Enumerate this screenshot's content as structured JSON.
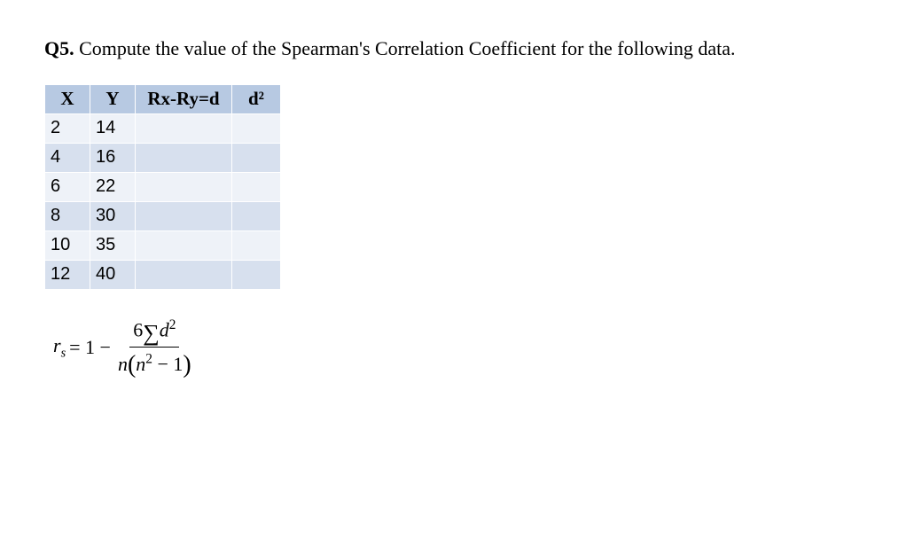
{
  "question": {
    "number": "Q5.",
    "text": "Compute the value of the Spearman's Correlation Coefficient for the following data."
  },
  "table": {
    "headers": {
      "x": "X",
      "y": "Y",
      "d": "Rx-Ry=d",
      "d2": "d²"
    },
    "rows": [
      {
        "x": "2",
        "y": "14",
        "d": "",
        "d2": ""
      },
      {
        "x": "4",
        "y": "16",
        "d": "",
        "d2": ""
      },
      {
        "x": "6",
        "y": "22",
        "d": "",
        "d2": ""
      },
      {
        "x": "8",
        "y": "30",
        "d": "",
        "d2": ""
      },
      {
        "x": "10",
        "y": "35",
        "d": "",
        "d2": ""
      },
      {
        "x": "12",
        "y": "40",
        "d": "",
        "d2": ""
      }
    ]
  },
  "formula": {
    "lhs_r": "r",
    "lhs_sub": "s",
    "eq": " = 1 − ",
    "num_6": "6",
    "num_d": "d",
    "num_exp": "2",
    "den_n1": "n",
    "den_n2": "n",
    "den_exp": "2",
    "den_minus1": " − 1"
  }
}
